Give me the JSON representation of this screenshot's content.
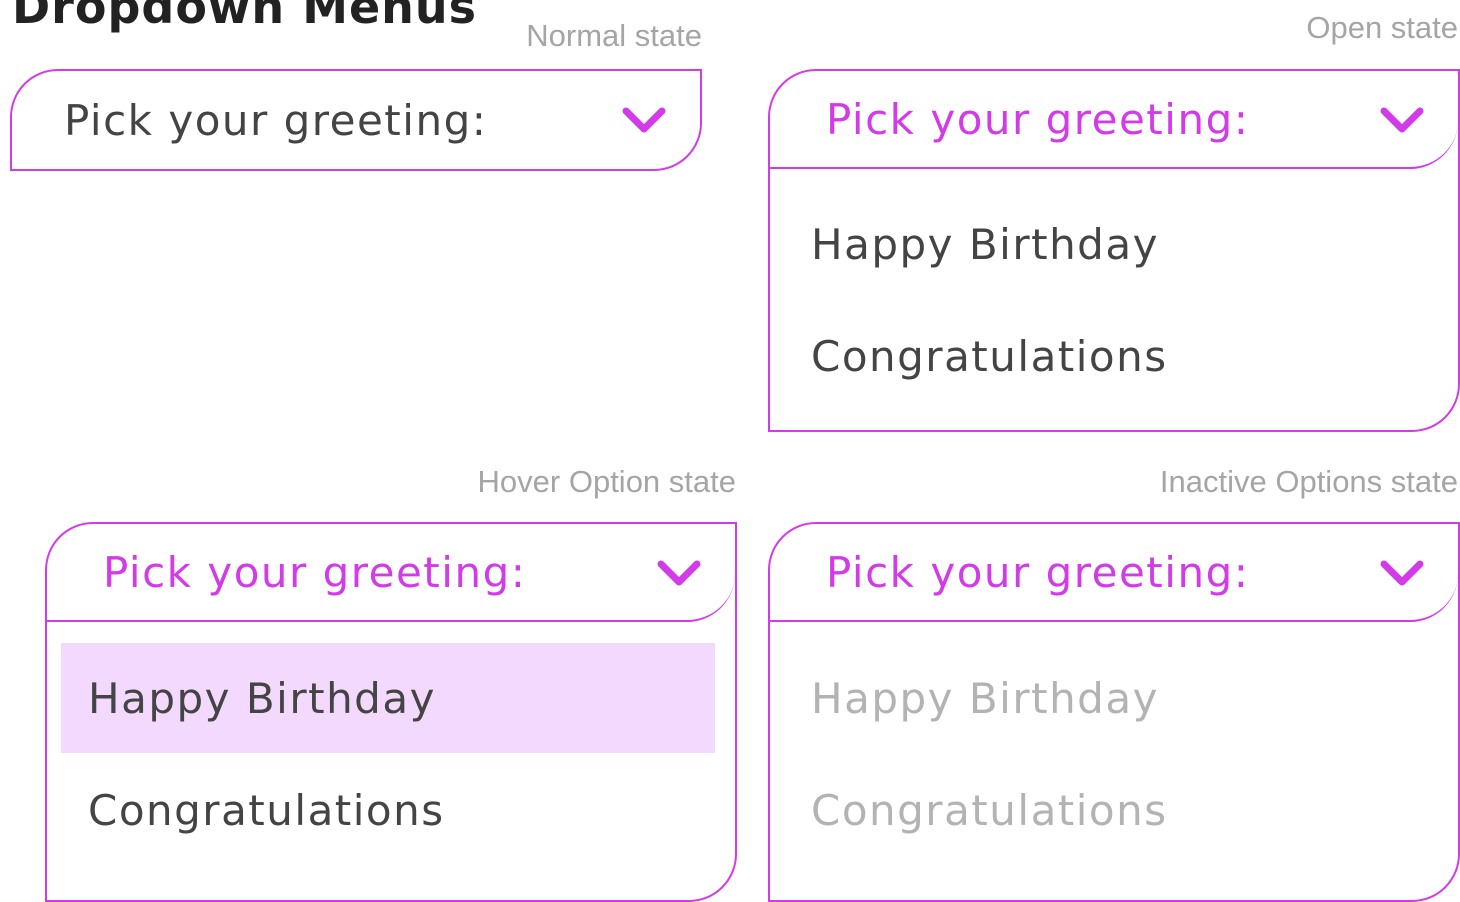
{
  "page": {
    "title": "Dropdown Menus"
  },
  "colors": {
    "accent": "#d43be8",
    "text": "#444444",
    "inactive_text": "#b3b3b3",
    "state_label": "#a5a5a5",
    "hover_bg": "#f3d9fd"
  },
  "icons": {
    "dropdown_toggle": "chevron-down-icon"
  },
  "dropdowns": {
    "normal": {
      "state_label": "Normal state",
      "title": "Pick your greeting:"
    },
    "open": {
      "state_label": "Open state",
      "title": "Pick your greeting:",
      "options": [
        "Happy Birthday",
        "Congratulations"
      ]
    },
    "hover": {
      "state_label": "Hover Option state",
      "title": "Pick your greeting:",
      "options": [
        "Happy Birthday",
        "Congratulations"
      ],
      "hovered_option": "Happy Birthday"
    },
    "inactive": {
      "state_label": "Inactive Options state",
      "title": "Pick your greeting:",
      "options": [
        "Happy Birthday",
        "Congratulations"
      ]
    }
  }
}
